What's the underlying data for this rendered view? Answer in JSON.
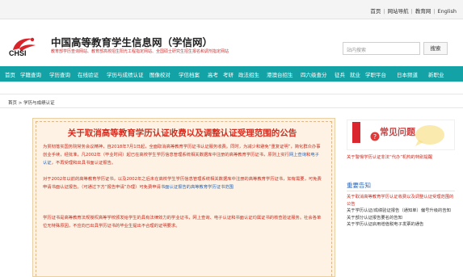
{
  "top_links": [
    "首页",
    "网站导航",
    "教育网",
    "English"
  ],
  "header": {
    "logo_text": "CHSI",
    "title": "中国高等教育学生信息网（学信网）",
    "subtitle": "教育部学历查询网站、教育部高校招生阳光工程指定网站、全国硕士研究生招生报名和调剂指定网站",
    "search_placeholder": "站内搜索",
    "search_button": "搜索"
  },
  "nav": [
    "首页",
    "学籍查询",
    "学历查询",
    "在线验证",
    "学历与成绩认证",
    "图像校对",
    "学信档案",
    "高考",
    "考研",
    "政法招生",
    "港澳台招生",
    "四六级查分",
    "征兵",
    "就业",
    "学职平台",
    "日本频道",
    "新职业"
  ],
  "breadcrumb": "首页 > 学历与成绩认证",
  "notice": {
    "title": "关于取消高等教育学历认证收费以及调整认证受理范围的公告",
    "p1_a": "为贯彻落实国务院常务会议精神，自2018年7月1日起，全面取消高等教育学历证书认证服务收费。同时，为减少和避免“重复证明”，简化群众办事创业手续，经批准，凡2002年（毕业时间）起已在高校学生学历信息管理系统相关数据库中注册的高等教育学历证书，原则上实行",
    "p1_link1": "网上查询",
    "p1_b": "和",
    "p1_link2": "电子认证",
    "p1_c": "，不再受理和出具书面认证报告。",
    "p2_a": "对于2002年以前的高等教育学历证书，以及2002年之后未在高校学生学历信息管理系统相关数据库中注册的高等教育学历证书，如有需要，可免费申请书面认证报告。（可通过下方“报告申请”办理）可免费申请",
    "p2_link": "书面认证报告的高等教育学历证书范围",
    "p3": "学历证书是高等教育法规授权高等学校颁发给学生的具有法律效力的学业证书，网上查询、电子认证和书面认证均属证书的核查验证服务。社会各单位无特殊原因，不应向已出具学历证书的毕业生提出不合理的证明要求。"
  },
  "sidebar": {
    "faq_title": "常见问题",
    "faq_link": "关于警惕学历认证非法“代办”机构的特别提醒",
    "important_title": "重要告知",
    "important_items": [
      {
        "text": "关于取消高等教育学历认证收费以及调整认证受理范围的公告",
        "color": "red"
      },
      {
        "text": "关于学历认证/成绩验证报告（通知单）偏号升级的告知",
        "color": "normal"
      },
      {
        "text": "关于部分认证报告要名的告知",
        "color": "normal"
      },
      {
        "text": "关于学历认证启用增值税电子发票的通告",
        "color": "normal"
      }
    ]
  },
  "colors": {
    "nav_bg": "#13a3a6",
    "notice_bg": "#fdf2e3",
    "accent_red": "#c8281c",
    "link_blue": "#2a66b8"
  }
}
